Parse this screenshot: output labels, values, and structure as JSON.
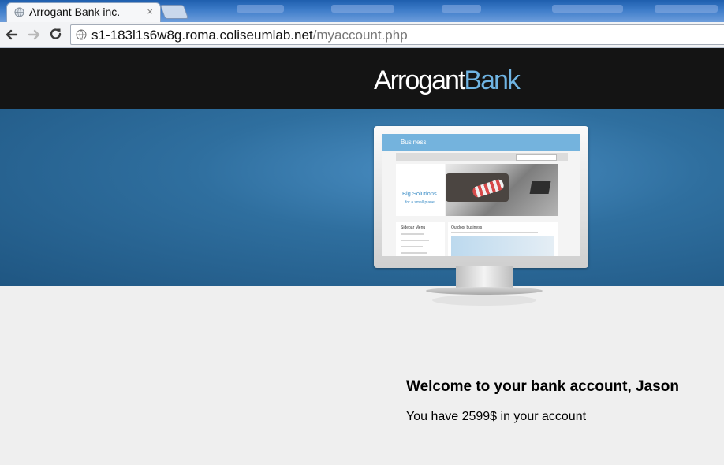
{
  "browser": {
    "tab": {
      "title": "Arrogant Bank inc.",
      "close_glyph": "×",
      "favicon": "globe-icon"
    },
    "url": {
      "host": "s1-183l1s6w8g.roma.coliseumlab.net",
      "path": "/myaccount.php"
    },
    "nav_icons": [
      "back-arrow-icon",
      "forward-arrow-icon",
      "reload-icon"
    ]
  },
  "site": {
    "logo": {
      "part1": "Arrogant",
      "part2": "Bank"
    },
    "banner_mockup": {
      "brand": "Business",
      "hero_line1": "Big Solutions",
      "hero_line2": "for a small planet",
      "sidebar_title": "Sidebar Menu",
      "main_title": "Outdoor business"
    },
    "welcome": "Welcome to your bank account, Jason",
    "balance_text": "You have 2599$ in your account"
  },
  "colors": {
    "header_bg": "#141414",
    "logo_accent": "#6fb4e3",
    "banner": "#2f6f9f",
    "page_bg": "#efefef"
  }
}
